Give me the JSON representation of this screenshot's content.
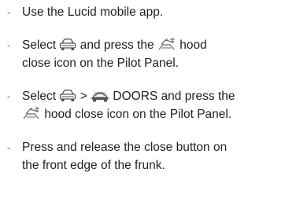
{
  "instructions": {
    "bullet": "-",
    "step1": {
      "text": "Use the Lucid mobile app."
    },
    "step2": {
      "prefix": "Select",
      "middle": "and press the",
      "suffix_line1": "hood",
      "suffix_line2": "close icon on the Pilot Panel.",
      "icons": [
        "vehicle-icon",
        "hood-close-icon"
      ]
    },
    "step3": {
      "prefix": "Select",
      "separator": ">",
      "doors_label": "DOORS",
      "middle": "and press the",
      "suffix": "hood close icon on the Pilot Panel.",
      "icons": [
        "vehicle-icon",
        "car-doors-icon",
        "hood-close-icon"
      ]
    },
    "step4": {
      "text_line1": "Press and release the close button on",
      "text_line2": "the front edge of the frunk."
    }
  }
}
